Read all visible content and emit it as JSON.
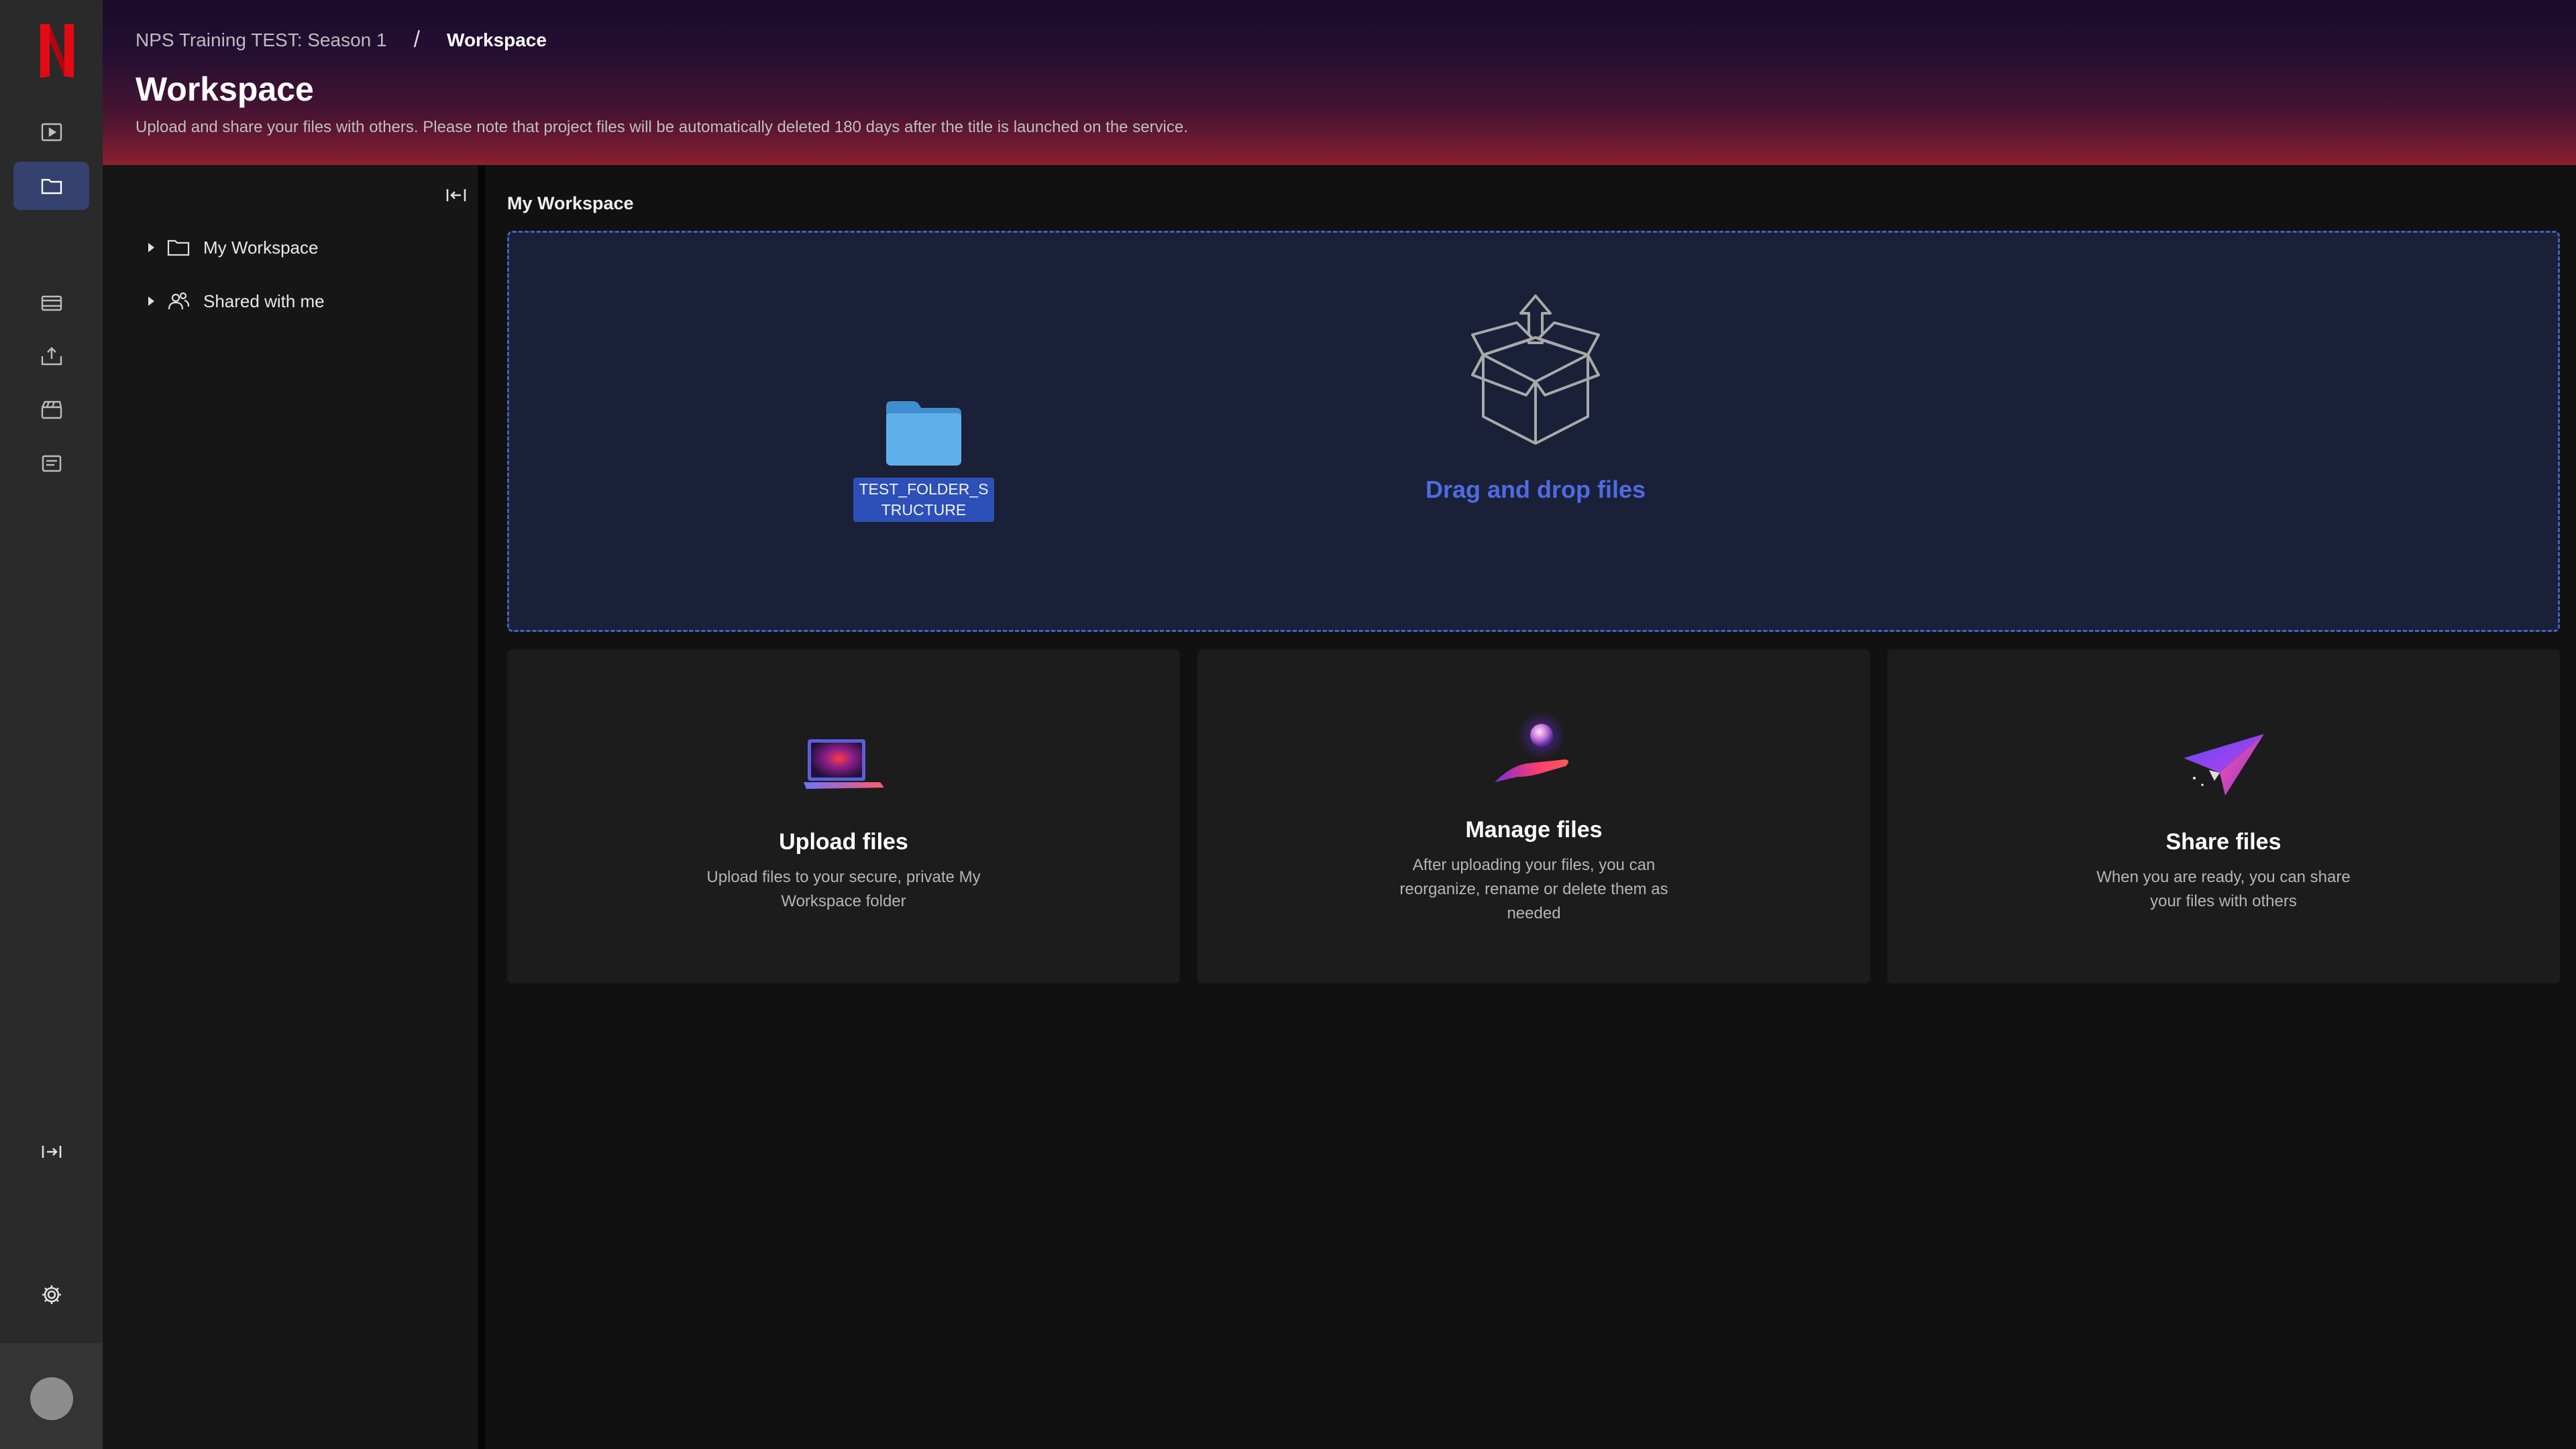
{
  "colors": {
    "rail_bg": "#2a2a2a",
    "rail_active": "#35416e",
    "dropzone_bg": "#1a2038",
    "dropzone_border": "#4560c8",
    "accent_text": "#4f6be0",
    "netflix_red": "#e50914"
  },
  "rail": {
    "logo": "netflix-logo",
    "items": [
      {
        "icon": "video-play-icon",
        "active": false
      },
      {
        "icon": "folder-icon",
        "active": true
      },
      {
        "icon": "film-strip-icon",
        "active": false
      },
      {
        "icon": "upload-tray-icon",
        "active": false
      },
      {
        "icon": "clapperboard-icon",
        "active": false
      },
      {
        "icon": "document-list-icon",
        "active": false
      }
    ],
    "expand_icon": "expand-sidebar-icon",
    "settings_icon": "gear-icon"
  },
  "header": {
    "breadcrumb": {
      "parent": "NPS Training TEST: Season 1",
      "separator": "/",
      "current": "Workspace"
    },
    "title": "Workspace",
    "subtitle": "Upload and share your files with others. Please note that project files will be automatically deleted 180 days after the title is launched on the service."
  },
  "tree": {
    "collapse_icon": "collapse-panel-icon",
    "items": [
      {
        "label": "My Workspace",
        "icon": "folder-outline-icon"
      },
      {
        "label": "Shared with me",
        "icon": "shared-users-icon"
      }
    ]
  },
  "main": {
    "section_label": "My Workspace",
    "dropzone": {
      "folder_name": "TEST_FOLDER_STRUCTURE",
      "drop_text": "Drag and drop files"
    },
    "cards": [
      {
        "title": "Upload files",
        "description": "Upload files to your secure, private My Workspace folder",
        "icon": "laptop-illustration"
      },
      {
        "title": "Manage files",
        "description": "After uploading your files, you can reorganize, rename or delete them as needed",
        "icon": "hand-orb-illustration"
      },
      {
        "title": "Share files",
        "description": "When you are ready, you can share your files with others",
        "icon": "paper-plane-illustration"
      }
    ]
  }
}
